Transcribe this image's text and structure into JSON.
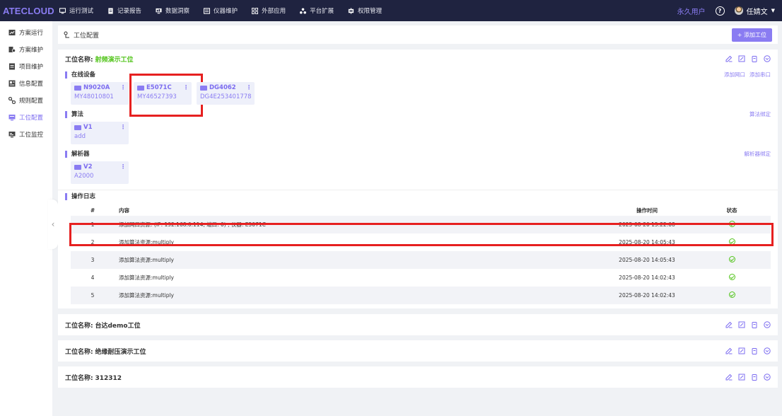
{
  "app": {
    "logo": "ATECLOUD"
  },
  "nav": [
    {
      "label": "运行测试",
      "icon": "monitor-icon"
    },
    {
      "label": "记录报告",
      "icon": "file-icon"
    },
    {
      "label": "数据洞察",
      "icon": "insight-icon"
    },
    {
      "label": "仪器维护",
      "icon": "instrument-icon"
    },
    {
      "label": "外部应用",
      "icon": "grid-icon"
    },
    {
      "label": "平台扩展",
      "icon": "extension-icon"
    },
    {
      "label": "权限管理",
      "icon": "permission-icon"
    }
  ],
  "header_right": {
    "license": "永久用户",
    "help": "?",
    "user": "任婧文"
  },
  "sidebar": [
    {
      "label": "方案运行",
      "icon": "run-icon",
      "active": false
    },
    {
      "label": "方案维护",
      "icon": "maintain-icon",
      "active": false
    },
    {
      "label": "项目维护",
      "icon": "project-icon",
      "active": false
    },
    {
      "label": "信息配置",
      "icon": "info-icon",
      "active": false
    },
    {
      "label": "规则配置",
      "icon": "rule-icon",
      "active": false
    },
    {
      "label": "工位配置",
      "icon": "station-icon",
      "active": true
    },
    {
      "label": "工位监控",
      "icon": "monitor-station-icon",
      "active": false
    }
  ],
  "page": {
    "title": "工位配置",
    "add_button": "+ 添加工位"
  },
  "workstation": {
    "label": "工位名称:",
    "name": "射频演示工位",
    "online_devices": {
      "title": "在线设备",
      "links": [
        "添加网口",
        "添加串口"
      ],
      "cards": [
        {
          "title": "N9020A",
          "sub": "MY48010801"
        },
        {
          "title": "E5071C",
          "sub": "MY46527393"
        },
        {
          "title": "DG4062",
          "sub": "DG4E253401778"
        }
      ]
    },
    "algorithm": {
      "title": "算法",
      "link": "算法绑定",
      "cards": [
        {
          "title": "V1",
          "sub": "add"
        }
      ]
    },
    "parser": {
      "title": "解析器",
      "link": "解析器绑定",
      "cards": [
        {
          "title": "V2",
          "sub": "A2000"
        }
      ]
    },
    "log": {
      "title": "操作日志",
      "headers": {
        "idx": "#",
        "content": "内容",
        "time": "操作时间",
        "status": "状态"
      },
      "rows": [
        {
          "idx": "1",
          "content": "添加网口资源: (IP: 192.168.0.114, 端口: 0) , 仪器: E5071C",
          "time": "2025-08-20 15:22:08"
        },
        {
          "idx": "2",
          "content": "添加算法资源:multiply",
          "time": "2025-08-20 14:05:43"
        },
        {
          "idx": "3",
          "content": "添加算法资源:multiply",
          "time": "2025-08-20 14:05:43"
        },
        {
          "idx": "4",
          "content": "添加算法资源:multiply",
          "time": "2025-08-20 14:02:43"
        },
        {
          "idx": "5",
          "content": "添加算法资源:multiply",
          "time": "2025-08-20 14:02:43"
        }
      ]
    }
  },
  "other_workstations": [
    {
      "label": "工位名称:",
      "name": "台达demo工位"
    },
    {
      "label": "工位名称:",
      "name": "绝缘耐压演示工位"
    },
    {
      "label": "工位名称:",
      "name": "312312"
    }
  ],
  "colors": {
    "accent": "#8a7cf2",
    "nav_bg": "#1f2340",
    "success": "#52c41a",
    "highlight": "#e62020"
  }
}
